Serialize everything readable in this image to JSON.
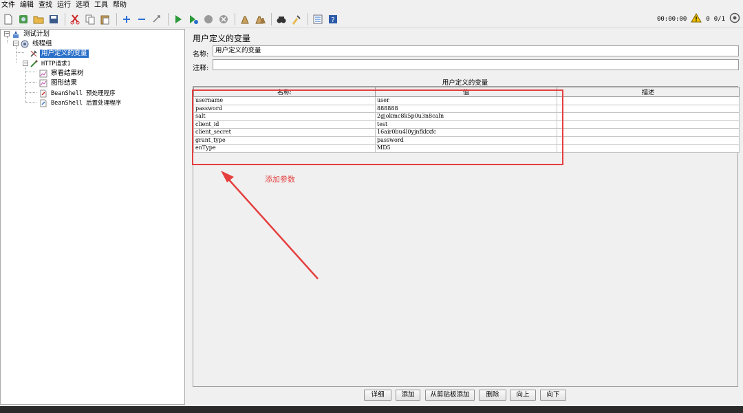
{
  "menu": [
    "文件",
    "编辑",
    "查找",
    "运行",
    "选项",
    "工具",
    "帮助"
  ],
  "toolbar": {
    "icons": [
      "new-icon",
      "templates-icon",
      "open-icon",
      "save-icon",
      "cut-icon",
      "copy-icon",
      "paste-icon",
      "expand-icon",
      "collapse-icon",
      "toggle-icon",
      "start-icon",
      "start-no-pause-icon",
      "stop-icon",
      "shutdown-icon",
      "clear-icon",
      "clear-all-icon",
      "search-icon",
      "reset-search-icon",
      "function-helper-icon",
      "help-icon"
    ],
    "timer": "00:00:00",
    "warnings": "0",
    "threads": "0/1"
  },
  "tree": {
    "root": "测试计划",
    "thread_group": "线程组",
    "selected": "用户定义的变量",
    "http": "HTTP请求1",
    "view_results": "察看结果树",
    "graph": "图形结果",
    "pre": "BeanShell 预处理程序",
    "post": "BeanShell 后置处理程序"
  },
  "panel": {
    "title": "用户定义的变量",
    "name_label": "名称:",
    "name_value": "用户定义的变量",
    "comment_label": "注释:",
    "comment_value": "",
    "table_title": "用户定义的变量"
  },
  "table": {
    "headers": [
      "名称:",
      "值",
      "描述"
    ],
    "rows": [
      [
        "username",
        "user",
        ""
      ],
      [
        "password",
        "888888",
        ""
      ],
      [
        "salt",
        "2gjokmc8k5p0u3n8caln",
        ""
      ],
      [
        "client_id",
        "test",
        ""
      ],
      [
        "client_secret",
        "16air0bu4l0yjnfkkxfc",
        ""
      ],
      [
        "grant_type",
        "password",
        ""
      ],
      [
        "enType",
        "MD5",
        ""
      ]
    ]
  },
  "annotation": "添加参数",
  "buttons": [
    "详细",
    "添加",
    "从剪贴板添加",
    "删除",
    "向上",
    "向下"
  ],
  "colors": {
    "annotation_red": "#e53e3e",
    "selection_blue": "#2a6fc9"
  }
}
